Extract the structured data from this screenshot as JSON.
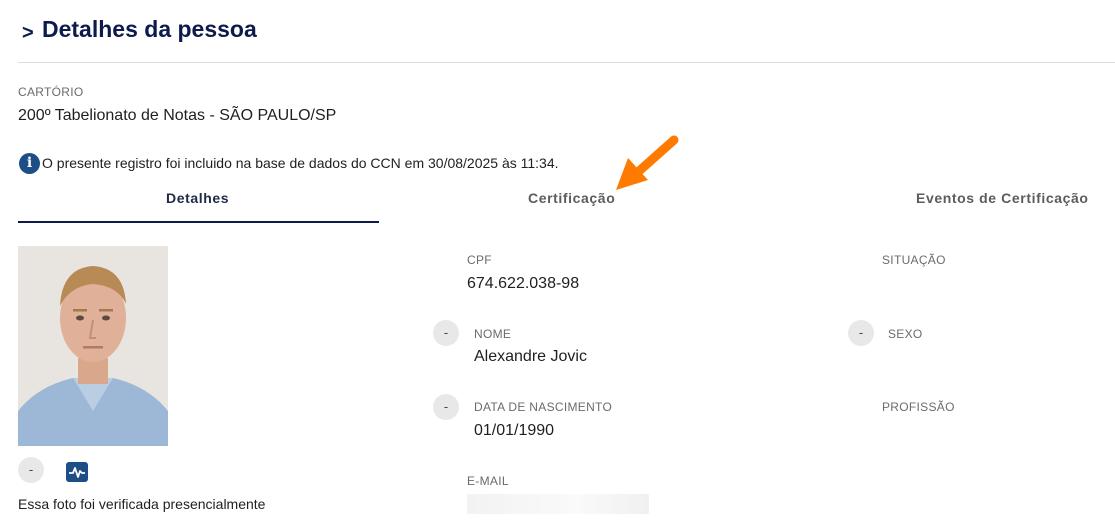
{
  "header": {
    "chevron": ">",
    "title": "Detalhes da pessoa"
  },
  "cartorio": {
    "label": "CARTÓRIO",
    "value": "200º Tabelionato de Notas - SÃO PAULO/SP"
  },
  "info": {
    "icon": "info-icon",
    "text": "O presente registro foi incluido na base de dados do CCN em 30/08/2025 às 11:34."
  },
  "tabs": [
    {
      "label": "Detalhes",
      "active": true
    },
    {
      "label": "Certificação",
      "active": false
    },
    {
      "label": "Eventos de Certificação",
      "active": false
    }
  ],
  "photo": {
    "dash_label": "-",
    "caption": "Essa foto foi verificada presencialmente"
  },
  "fields": {
    "cpf": {
      "label": "CPF",
      "value": "674.622.038-98"
    },
    "situacao": {
      "label": "SITUAÇÃO",
      "value": ""
    },
    "nome": {
      "label": "NOME",
      "value": "Alexandre Jovic",
      "dash": "-"
    },
    "sexo": {
      "label": "SEXO",
      "value": "",
      "dash": "-"
    },
    "nascimento": {
      "label": "DATA DE NASCIMENTO",
      "value": "01/01/1990",
      "dash": "-"
    },
    "profissao": {
      "label": "PROFISSÃO",
      "value": ""
    },
    "email": {
      "label": "E-MAIL",
      "value": ""
    }
  },
  "colors": {
    "navy": "#0d1b4c",
    "info_blue": "#1d4f86",
    "arrow_orange": "#ff7a00"
  }
}
